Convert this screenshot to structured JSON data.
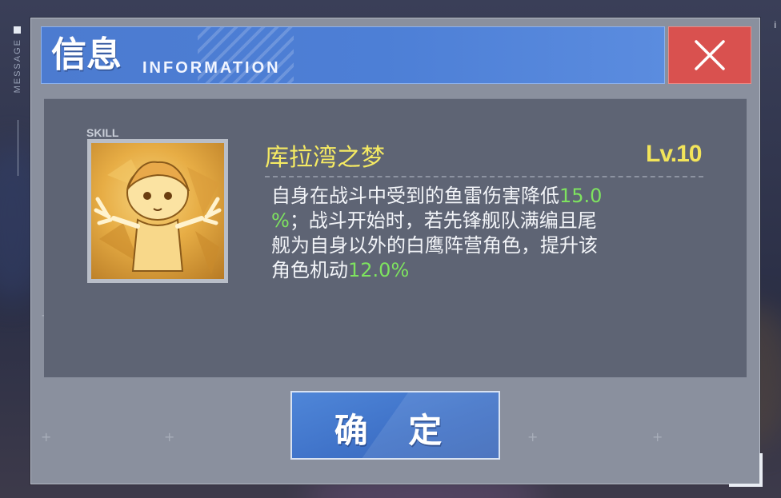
{
  "sidebar": {
    "label": "MESSAGE"
  },
  "header": {
    "title_cn": "信息",
    "title_en": "INFORMATION"
  },
  "skill": {
    "tag": "SKILL",
    "name": "库拉湾之梦",
    "level": "Lv.10",
    "description_lines": [
      {
        "text": "自身在战斗中受到的鱼雷伤害降低",
        "highlight": "15.0"
      },
      {
        "highlight_lead": "%",
        "text": "；战斗开始时，若先锋舰队满编且尾"
      },
      {
        "text": "舰为自身以外的白鹰阵营角色，提升该"
      },
      {
        "text": "角色机动",
        "highlight": "12.0%"
      }
    ]
  },
  "buttons": {
    "confirm": "确 定"
  },
  "colors": {
    "header_blue": "#4c7bd0",
    "close_red": "#d9514f",
    "skill_name_yellow": "#f5ea63",
    "highlight_green": "#7ee35f",
    "panel_gray": "#5e6474"
  },
  "icons": {
    "close": "close-x-icon",
    "skill": "skill-portrait-icon"
  }
}
